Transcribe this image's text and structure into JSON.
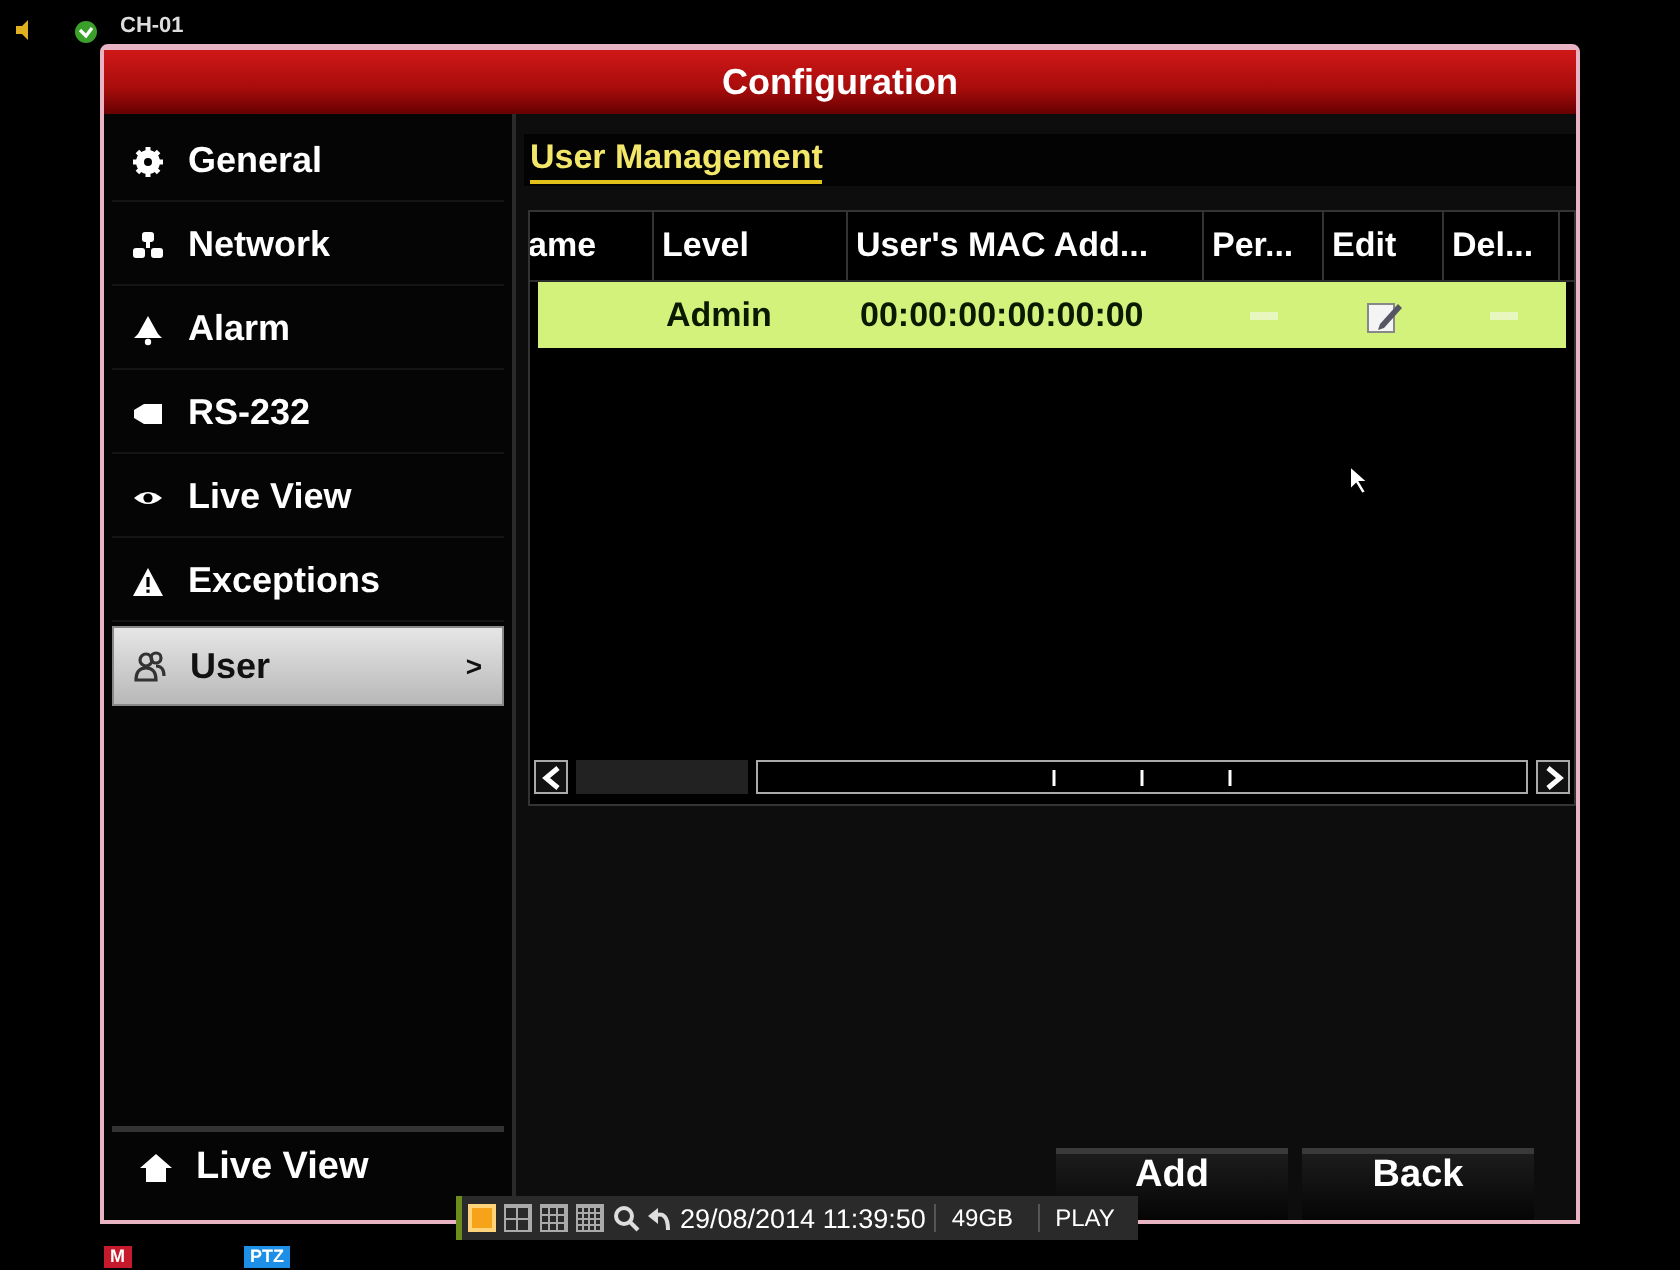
{
  "osd": {
    "channel": "CH-01",
    "badges": [
      {
        "text": "M",
        "color": "#c41a2c"
      },
      {
        "text": "PTZ",
        "color": "#1e8fe6"
      }
    ]
  },
  "window": {
    "title": "Configuration"
  },
  "sidebar": {
    "items": [
      {
        "label": "General",
        "selected": false
      },
      {
        "label": "Network",
        "selected": false
      },
      {
        "label": "Alarm",
        "selected": false
      },
      {
        "label": "RS-232",
        "selected": false
      },
      {
        "label": "Live View",
        "selected": false
      },
      {
        "label": "Exceptions",
        "selected": false
      },
      {
        "label": "User",
        "selected": true,
        "arrow": ">"
      }
    ],
    "footer": "Live View"
  },
  "section": {
    "title": "User Management"
  },
  "table": {
    "columns": [
      "ame",
      "Level",
      "User's MAC Add...",
      "Per...",
      "Edit",
      "Del..."
    ],
    "rows": [
      {
        "level": "Admin",
        "mac": "00:00:00:00:00:00",
        "permission_enabled": false,
        "delete_enabled": false,
        "selected": true
      }
    ]
  },
  "buttons": [
    "Add",
    "Back"
  ],
  "toolbar": {
    "layouts": [
      {
        "selected": true
      },
      {
        "selected": false
      },
      {
        "selected": false
      },
      {
        "selected": false
      }
    ],
    "datetime": "29/08/2014 11:39:50",
    "disk": "49GB",
    "mode": "PLAY"
  }
}
